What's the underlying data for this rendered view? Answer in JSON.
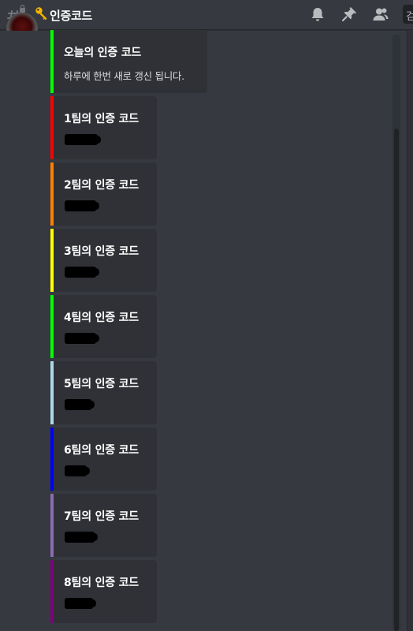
{
  "header": {
    "channel_name": "인증코드",
    "icons": [
      "hashtag-lock-icon",
      "key-icon",
      "bell-icon",
      "pin-icon",
      "members-icon"
    ],
    "search_stub": "검"
  },
  "embeds": [
    {
      "title": "오늘의 인증 코드",
      "description": "하루에 한번 새로 갱신 됩니다.",
      "color": "#00ff00"
    },
    {
      "title": "1팀의 인증 코드",
      "color": "#ff0000"
    },
    {
      "title": "2팀의 인증 코드",
      "color": "#ff8000"
    },
    {
      "title": "3팀의 인증 코드",
      "color": "#ffff00"
    },
    {
      "title": "4팀의 인증 코드",
      "color": "#00ff00"
    },
    {
      "title": "5팀의 인증 코드",
      "color": "#add8e6"
    },
    {
      "title": "6팀의 인증 코드",
      "color": "#0000ff"
    },
    {
      "title": "7팀의 인증 코드",
      "color": "#8b6bb0"
    },
    {
      "title": "8팀의 인증 코드",
      "color": "#800080"
    }
  ],
  "colors": {
    "background": "#36393f",
    "embed_background": "#2f3136",
    "title": "#ffffff",
    "text": "#dcddde",
    "icon": "#b9bbbe"
  }
}
